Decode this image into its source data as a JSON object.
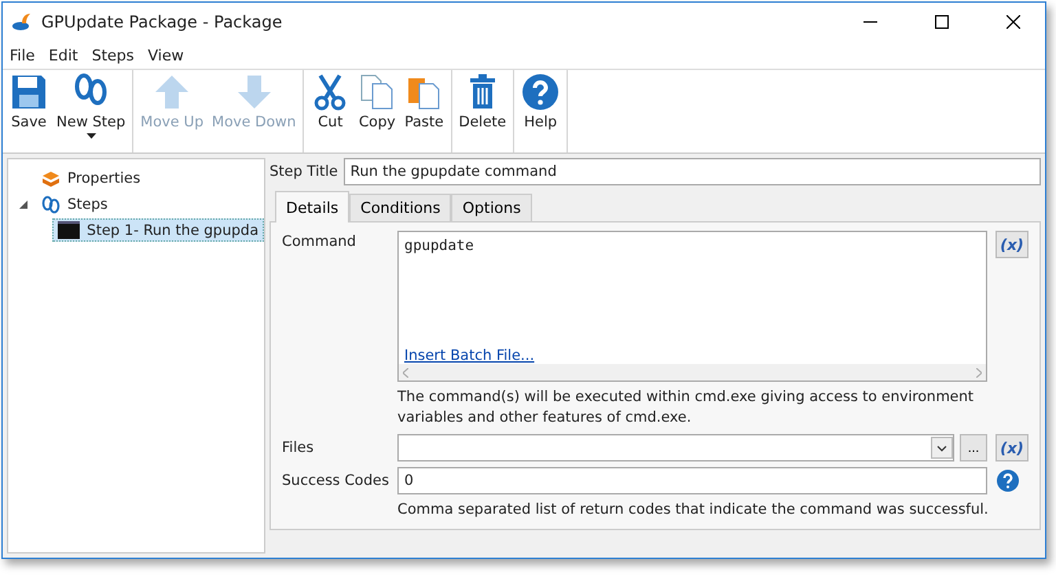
{
  "window": {
    "title": "GPUpdate Package - Package"
  },
  "menu": [
    "File",
    "Edit",
    "Steps",
    "View"
  ],
  "toolbar": [
    [
      {
        "label": "Save",
        "kind": "save",
        "disabled": false
      },
      {
        "label": "New Step",
        "kind": "new",
        "disabled": false
      }
    ],
    [
      {
        "label": "Move Up",
        "kind": "up",
        "disabled": true
      },
      {
        "label": "Move Down",
        "kind": "down",
        "disabled": true
      }
    ],
    [
      {
        "label": "Cut",
        "kind": "cut",
        "disabled": false
      },
      {
        "label": "Copy",
        "kind": "copy",
        "disabled": false
      },
      {
        "label": "Paste",
        "kind": "paste",
        "disabled": false
      }
    ],
    [
      {
        "label": "Delete",
        "kind": "delete",
        "disabled": false
      }
    ],
    [
      {
        "label": "Help",
        "kind": "help",
        "disabled": false
      }
    ]
  ],
  "tree": [
    {
      "label": "Properties",
      "kind": "properties",
      "selected": false
    },
    {
      "label": "Steps",
      "kind": "steps",
      "selected": false,
      "expanded": true,
      "children": [
        {
          "label": "Step 1- Run the gpupda",
          "kind": "step",
          "selected": true
        }
      ]
    }
  ],
  "step_title": {
    "label": "Step Title",
    "value": "Run the gpupdate command"
  },
  "tabs": [
    {
      "label": "Details",
      "selected": true
    },
    {
      "label": "Conditions",
      "selected": false
    },
    {
      "label": "Options",
      "selected": false
    }
  ],
  "command": {
    "label": "Command",
    "value": "gpupdate",
    "link": "Insert Batch File...",
    "variable_button": "(x)",
    "hint": "The command(s) will be executed within cmd.exe giving access to environment variables and other features of cmd.exe."
  },
  "files": {
    "label": "Files",
    "browse_button": "...",
    "variable_button": "(x)"
  },
  "success_codes": {
    "label": "Success Codes",
    "value": "0",
    "hint": "Comma separated list of return codes that indicate the command was successful."
  }
}
